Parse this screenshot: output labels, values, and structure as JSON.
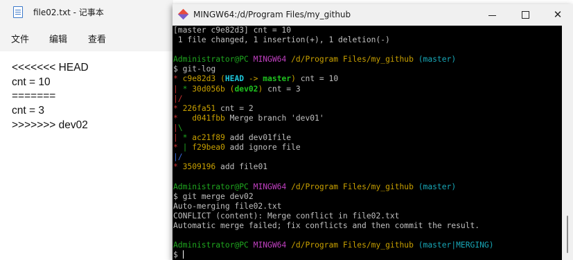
{
  "notepad": {
    "title": "file02.txt - 记事本",
    "menu": {
      "file": "文件",
      "edit": "编辑",
      "view": "查看"
    },
    "lines": [
      "<<<<<<< HEAD",
      "cnt = 10",
      "=======",
      "cnt = 3",
      ">>>>>>> dev02"
    ]
  },
  "terminal": {
    "title": "MINGW64:/d/Program Files/my_github",
    "window_buttons": {
      "minimize": "—",
      "maximize": "☐",
      "close": "✕"
    },
    "lines": {
      "l01": "[master c9e82d3] cnt = 10",
      "l02": " 1 file changed, 1 insertion(+), 1 deletion(-)",
      "p1_user": "Administrator@PC",
      "p1_sys": "MINGW64",
      "p1_path": "/d/Program Files/my_github",
      "p1_branch": "(master)",
      "cmd1": "$ git-log",
      "log1_star": "*",
      "log1_hash": "c9e82d3",
      "log1_open": "(",
      "log1_head": "HEAD",
      "log1_arrow": " -> ",
      "log1_master": "master",
      "log1_close": ")",
      "log1_msg": " cnt = 10",
      "log2_bar": "|",
      "log2_star": " *",
      "log2_hash": "30d056b",
      "log2_open": "(",
      "log2_dev": "dev02",
      "log2_close": ")",
      "log2_msg": " cnt = 3",
      "log3_slash": "|/",
      "log4_star": "*",
      "log4_hash": "226fa51",
      "log4_msg": " cnt = 2",
      "log5_star": "*",
      "log5_hash": "d041fbb",
      "log5_msg": " Merge branch 'dev01'",
      "log6_bar": "|",
      "log6_back": "\\",
      "log7_bar": "|",
      "log7_star": " *",
      "log7_hash": "ac21f89",
      "log7_msg": " add dev01file",
      "log8_star": "*",
      "log8_bar": " |",
      "log8_hash": "f29bea0",
      "log8_msg": " add ignore file",
      "log9_bar": "|/",
      "log10_star": "*",
      "log10_hash": "3509196",
      "log10_msg": " add file01",
      "p2_user": "Administrator@PC",
      "p2_sys": "MINGW64",
      "p2_path": "/d/Program Files/my_github",
      "p2_branch": "(master)",
      "cmd2": "$ git merge dev02",
      "out1": "Auto-merging file02.txt",
      "out2": "CONFLICT (content): Merge conflict in file02.txt",
      "out3": "Automatic merge failed; fix conflicts and then commit the result.",
      "p3_user": "Administrator@PC",
      "p3_sys": "MINGW64",
      "p3_path": "/d/Program Files/my_github",
      "p3_branch": "(master|MERGING)",
      "prompt": "$"
    }
  },
  "colors": {
    "green": "#1fa81f",
    "magenta": "#c040c0",
    "yellow": "#c8a000",
    "cyan": "#18a8b8",
    "red": "#c83030",
    "blue": "#3a6ee0"
  }
}
